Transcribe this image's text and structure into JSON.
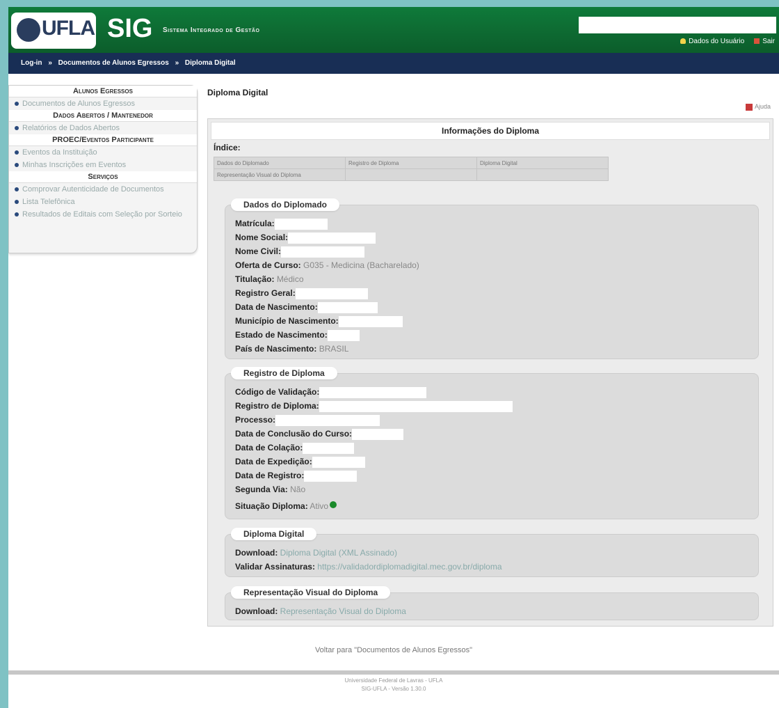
{
  "app": {
    "logo_text": "UFLA",
    "title": "SIG",
    "subtitle": "Sistema Integrado de Gestão"
  },
  "header": {
    "user_link": "Dados do Usuário",
    "exit_link": "Sair"
  },
  "breadcrumb": [
    "Log-in",
    "Documentos de Alunos Egressos",
    "Diploma Digital"
  ],
  "sidebar": {
    "sections": [
      {
        "title": "Alunos Egressos",
        "items": [
          "Documentos de Alunos Egressos"
        ]
      },
      {
        "title": "Dados Abertos / Mantenedor",
        "items": [
          "Relatórios de Dados Abertos"
        ]
      },
      {
        "title": "PROEC/Eventos Participante",
        "items": [
          "Eventos da Instituição",
          "Minhas Inscrições em Eventos"
        ]
      },
      {
        "title": "Serviços",
        "items": [
          "Comprovar Autenticidade de Documentos",
          "Lista Telefônica",
          "Resultados de Editais com Seleção por Sorteio"
        ]
      }
    ]
  },
  "page": {
    "title": "Diploma Digital",
    "help": "Ajuda"
  },
  "panel": {
    "title": "Informações do Diploma",
    "indice_label": "Índice:",
    "indice": [
      [
        "Dados do Diplomado",
        "Registro de Diploma",
        "Diploma Digital"
      ],
      [
        "Representação Visual do Diploma",
        "",
        ""
      ]
    ]
  },
  "dados": {
    "legend": "Dados do Diplomado",
    "matricula": "Matrícula:",
    "nome_social": "Nome Social:",
    "nome_civil": "Nome Civil:",
    "oferta_label": "Oferta de Curso:",
    "oferta_value": "G035 - Medicina (Bacharelado)",
    "titulacao_label": "Titulação:",
    "titulacao_value": "Médico",
    "rg": "Registro Geral:",
    "nascimento": "Data de Nascimento:",
    "municipio": "Município de Nascimento:",
    "estado": "Estado de Nascimento:",
    "pais_label": "País de Nascimento:",
    "pais_value": "BRASIL"
  },
  "registro": {
    "legend": "Registro de Diploma",
    "codigo": "Código de Validação:",
    "registro": "Registro de Diploma:",
    "processo": "Processo:",
    "conclusao": "Data de Conclusão do Curso:",
    "colacao": "Data de Colação:",
    "expedicao": "Data de Expedição:",
    "data_registro": "Data de Registro:",
    "segunda_label": "Segunda Via:",
    "segunda_value": "Não",
    "situacao_label": "Situação Diploma:",
    "situacao_value": "Ativo"
  },
  "digital": {
    "legend": "Diploma Digital",
    "download_label": "Download:",
    "download_link": "Diploma Digital (XML Assinado)",
    "validar_label": "Validar Assinaturas:",
    "validar_link": "https://validadordiplomadigital.mec.gov.br/diploma"
  },
  "visual": {
    "legend": "Representação Visual do Diploma",
    "download_label": "Download:",
    "download_link": "Representação Visual do Diploma"
  },
  "back_link": "Voltar para \"Documentos de Alunos Egressos\"",
  "footer": {
    "line1": "Universidade Federal de Lavras - UFLA",
    "line2": "SIG-UFLA - Versão 1.30.0"
  }
}
